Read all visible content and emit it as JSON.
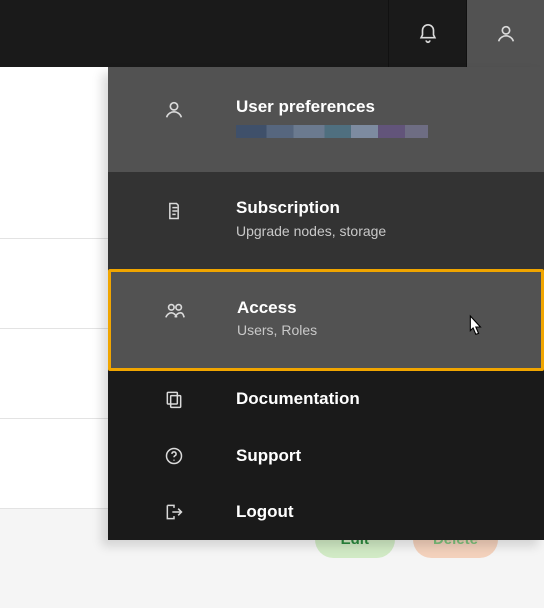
{
  "accent": {
    "highlight_border": "#f0a500"
  },
  "header": {
    "notifications_icon": "bell-icon",
    "account_icon": "user-icon"
  },
  "dropdown": {
    "preferences": {
      "title": "User preferences"
    },
    "subscription": {
      "title": "Subscription",
      "subtitle": "Upgrade nodes, storage"
    },
    "access": {
      "title": "Access",
      "subtitle": "Users, Roles"
    },
    "documentation": {
      "title": "Documentation"
    },
    "support": {
      "title": "Support"
    },
    "logout": {
      "title": "Logout"
    }
  },
  "buttons": {
    "edit": "Edit",
    "delete": "Delete"
  }
}
